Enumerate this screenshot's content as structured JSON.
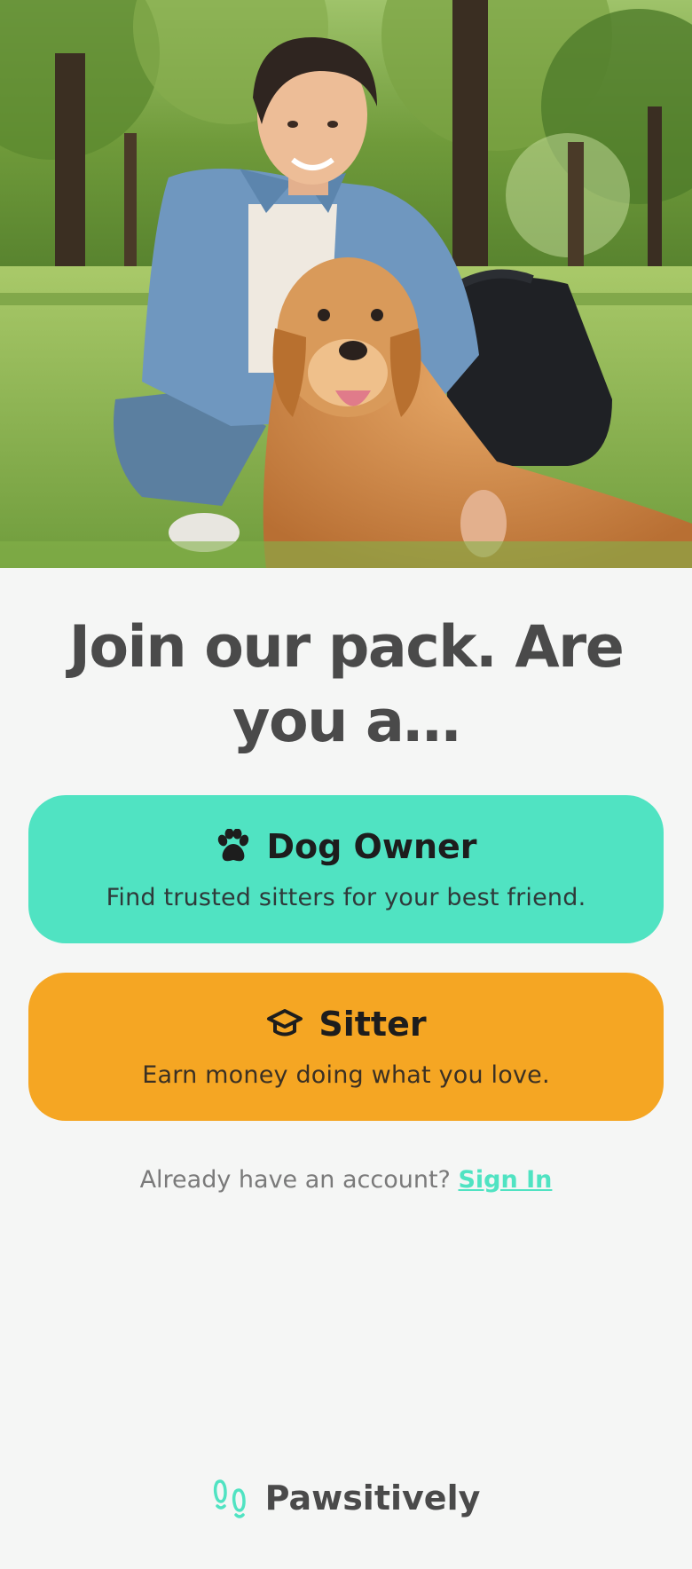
{
  "hero": {
    "image_alt": "Smiling young man crouching beside a golden retriever in a sunny park"
  },
  "heading": "Join our pack. Are you a…",
  "roles": [
    {
      "title": "Dog Owner",
      "description": "Find trusted sitters for your best friend.",
      "icon": "paw-icon",
      "color": "#50e3c2"
    },
    {
      "title": "Sitter",
      "description": "Earn money doing what you love.",
      "icon": "graduation-cap-icon",
      "color": "#f5a623"
    }
  ],
  "signin": {
    "prompt": "Already have an account?",
    "link": "Sign In"
  },
  "brand": {
    "name": "Pawsitively",
    "icon": "footprints-icon",
    "accent": "#50e3c2"
  }
}
